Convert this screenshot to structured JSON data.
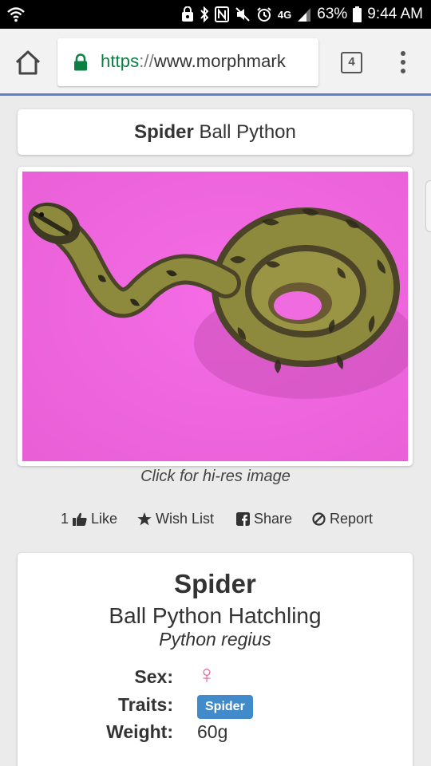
{
  "status_bar": {
    "network": "4G",
    "battery": "63%",
    "time": "9:44 AM"
  },
  "browser": {
    "url_scheme": "https",
    "url_separator": "://",
    "url_host": "www.morphmark",
    "tab_count": "4"
  },
  "listing": {
    "title_bold": "Spider",
    "title_rest": " Ball Python",
    "image_caption": "Click for hi-res image",
    "actions": {
      "like_count": "1",
      "like_label": "Like",
      "wishlist_label": "Wish List",
      "share_label": "Share",
      "report_label": "Report"
    },
    "details": {
      "morph": "Spider",
      "species": "Ball Python Hatchling",
      "latin": "Python regius",
      "sex_label": "Sex:",
      "sex_symbol": "♀",
      "traits_label": "Traits:",
      "trait": "Spider",
      "weight_label": "Weight:",
      "weight_value": "60g"
    }
  },
  "colors": {
    "url_scheme": "#0b8043",
    "trait_badge": "#428bca",
    "female_symbol": "#e0679f",
    "photo_background": "#f06ae0"
  }
}
